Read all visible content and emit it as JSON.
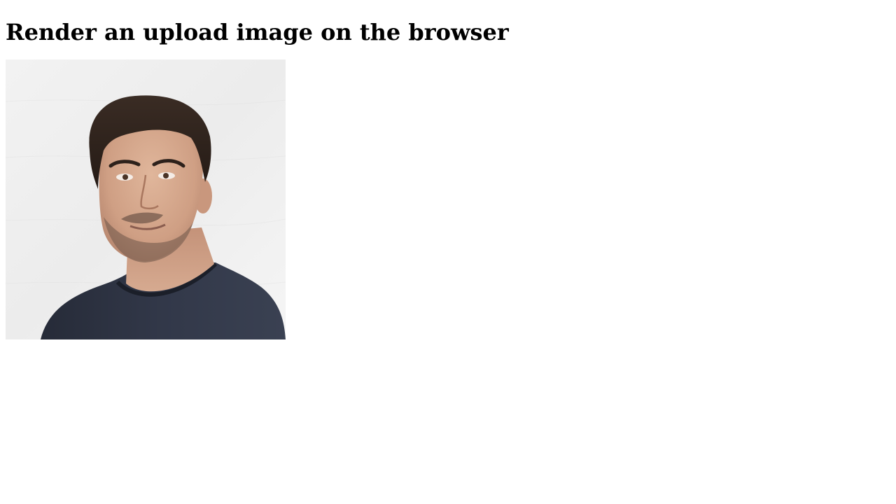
{
  "page": {
    "heading": "Render an upload image on the browser"
  },
  "image": {
    "alt": "Uploaded portrait photo",
    "subject": "portrait-photo"
  }
}
